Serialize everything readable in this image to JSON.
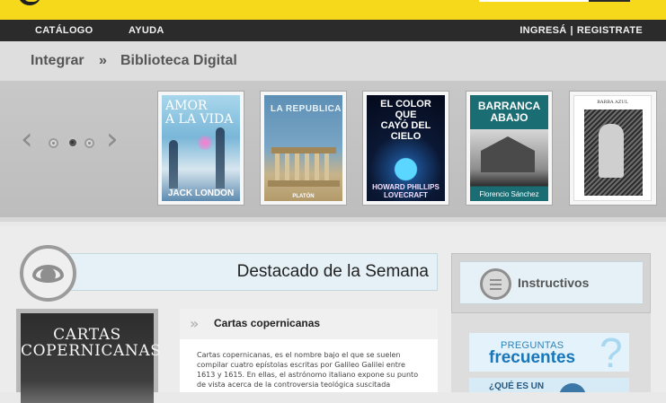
{
  "nav": {
    "catalogo": "CATÁLOGO",
    "ayuda": "AYUDA",
    "ingresa": "INGRESÁ",
    "separator": "|",
    "registrate": "REGISTRATE"
  },
  "breadcrumb": {
    "root": "Integrar",
    "separator": "»",
    "current": "Biblioteca Digital"
  },
  "carousel": {
    "prev_icon": "chevron-left-icon",
    "next_icon": "chevron-right-icon",
    "dots": 3,
    "active_dot": 2,
    "books": [
      {
        "title": "AMOR\nA LA VIDA",
        "author": "JACK LONDON"
      },
      {
        "title": "LA REPUBLICA",
        "author": "PLATÓN"
      },
      {
        "title": "EL COLOR QUE\nCAYÓ DEL CIELO",
        "author": "HOWARD PHILLIPS\nLOVECRAFT"
      },
      {
        "title": "BARRANCA\nABAJO",
        "author": "Florencio Sánchez"
      },
      {
        "title": "BARBA AZUL",
        "author": ""
      }
    ]
  },
  "featured": {
    "heading": "Destacado de la Semana",
    "icon": "eye-icon",
    "book_cover_title": "CARTAS\nCOPERNICANAS",
    "summary_title": "Cartas copernicanas",
    "summary_text": "Cartas copernicanas, es el nombre bajo el que se suelen compilar cuatro epístolas escritas por Galileo Galilei entre 1613 y 1615. En ellas, el astrónomo italiano expone su punto de vista acerca de la controversia teológica suscitada"
  },
  "sidebar": {
    "instructivos_label": "Instructivos",
    "instructivos_icon": "list-icon",
    "faq_small": "PREGUNTAS",
    "faq_big": "frecuentes",
    "faq_mark": "?",
    "whatis_label": "¿QUÉ ES UN"
  },
  "colors": {
    "brand_yellow": "#f6d91a",
    "nav_dark": "#2b2b2b",
    "accent_blue": "#1976b9"
  }
}
